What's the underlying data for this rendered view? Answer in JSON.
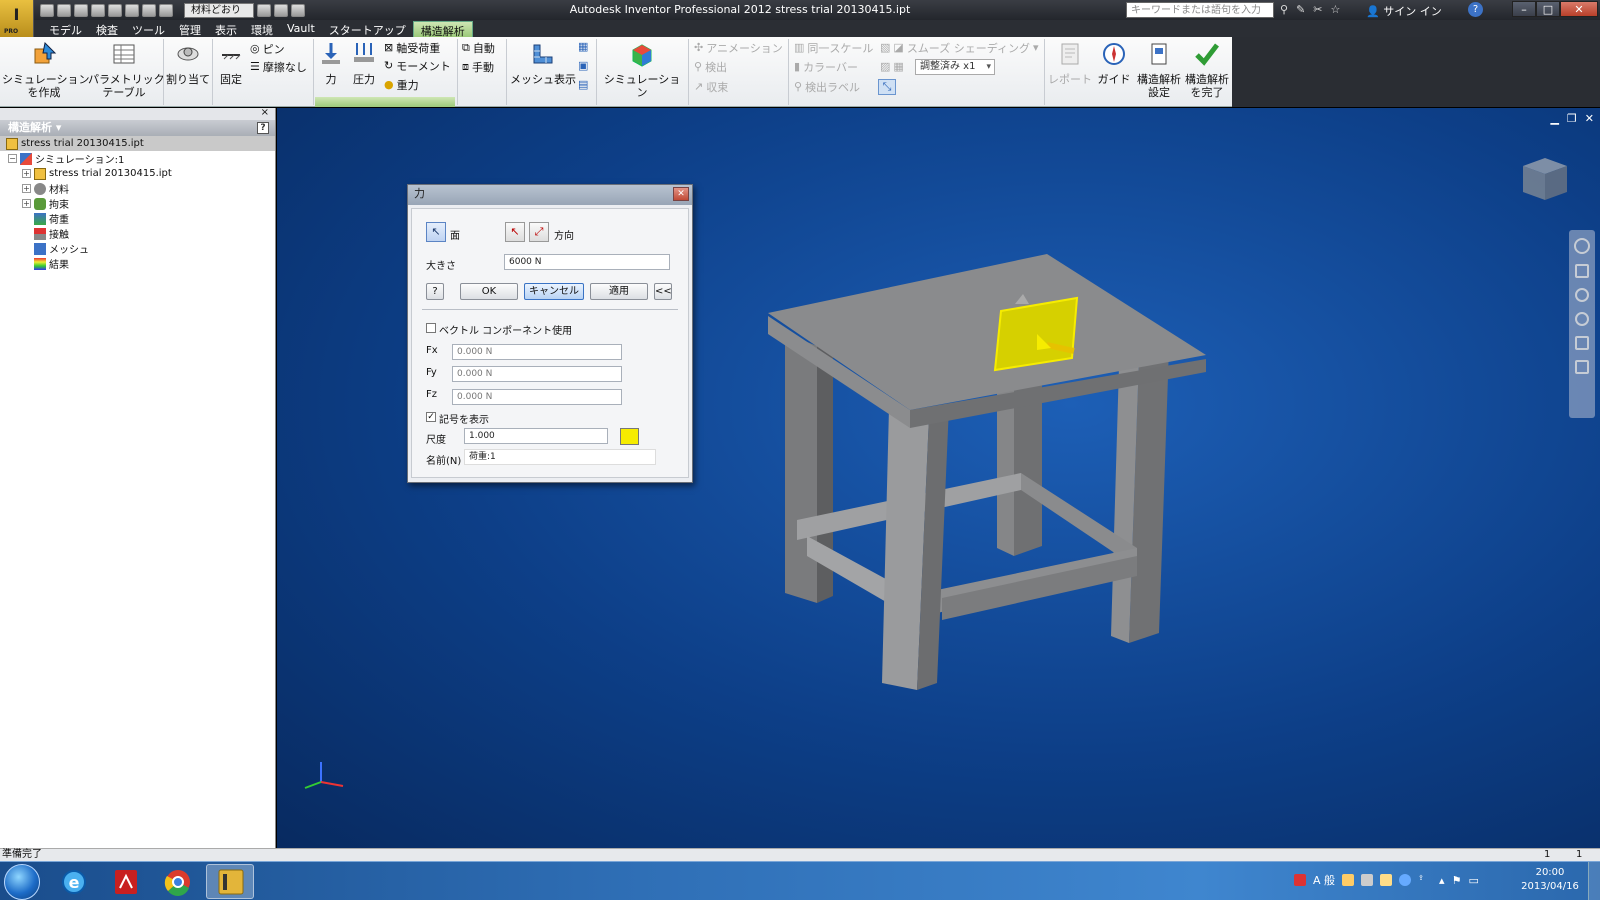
{
  "titlebar": {
    "title": "Autodesk Inventor Professional 2012    stress trial 20130415.ipt",
    "app_logo": "I",
    "app_logo_sub": "PRO",
    "qat_material": "材料どおり",
    "search_placeholder": "キーワードまたは語句を入力",
    "signin": "サイン イン",
    "help": "?"
  },
  "menu": {
    "tabs": [
      "モデル",
      "検査",
      "ツール",
      "管理",
      "表示",
      "環境",
      "Vault",
      "スタートアップ",
      "構造解析"
    ],
    "active_tab": "構造解析"
  },
  "ribbon": {
    "create_sim": "シミュレーション\nを作成",
    "param_table": "パラメトリック\nテーブル",
    "assign": "割り当て",
    "fixed": "固定",
    "pin": "ピン",
    "frictionless": "摩擦なし",
    "force": "力",
    "pressure": "圧力",
    "bearing": "軸受荷重",
    "moment": "モーメント",
    "gravity": "重力",
    "automatic": "自動",
    "manual": "手動",
    "mesh_view": "メッシュ表示",
    "simulation": "シミュレーション",
    "animation": "アニメーション",
    "probe": "検出",
    "converge": "収束",
    "same_scale": "同一スケール",
    "color_bar": "カラーバー",
    "probe_label": "検出ラベル",
    "smooth_shading": "スムーズ シェーディング",
    "adjusted": "調整済み x1",
    "report": "レポート",
    "guide": "ガイド",
    "sa_settings": "構造解析\n設定",
    "finish_sa": "構造解析\nを完了"
  },
  "browser": {
    "header": "構造解析 ▾",
    "help": "?",
    "close": "×",
    "items": [
      {
        "label": "stress trial 20130415.ipt",
        "level": 0,
        "expander": ""
      },
      {
        "label": "シミュレーション:1",
        "level": 0,
        "expander": "−"
      },
      {
        "label": "stress trial 20130415.ipt",
        "level": 1,
        "expander": "+"
      },
      {
        "label": "材料",
        "level": 1,
        "expander": "+"
      },
      {
        "label": "拘束",
        "level": 1,
        "expander": "+"
      },
      {
        "label": "荷重",
        "level": 1,
        "expander": ""
      },
      {
        "label": "接触",
        "level": 1,
        "expander": ""
      },
      {
        "label": "メッシュ",
        "level": 1,
        "expander": ""
      },
      {
        "label": "結果",
        "level": 1,
        "expander": ""
      }
    ]
  },
  "dialog": {
    "title": "力",
    "face_label": "面",
    "direction_label": "方向",
    "magnitude_label": "大きさ",
    "magnitude_value": "6000 N",
    "ok": "OK",
    "cancel": "キャンセル",
    "apply": "適用",
    "collapse": "<<",
    "help": "?",
    "vector_components": "ベクトル コンポーネント使用",
    "vector_checked": false,
    "fx_label": "Fx",
    "fy_label": "Fy",
    "fz_label": "Fz",
    "fx": "0.000 N",
    "fy": "0.000 N",
    "fz": "0.000 N",
    "show_glyph": "記号を表示",
    "show_glyph_checked": true,
    "scale_label": "尺度",
    "scale_value": "1.000",
    "glyph_color": "#f6ec00",
    "name_label": "名前(N)",
    "name_value": "荷重:1"
  },
  "statusbar": {
    "status": "準備完了",
    "n1": "1",
    "n2": "1"
  },
  "taskbar": {
    "time": "20:00",
    "date": "2013/04/16",
    "ime": "A 般"
  },
  "colors": {
    "viewport_bg": "#0d3f88",
    "part_gray": "#8a8b8d",
    "load_face": "#e6e000",
    "active_tab": "#9cc97a"
  }
}
